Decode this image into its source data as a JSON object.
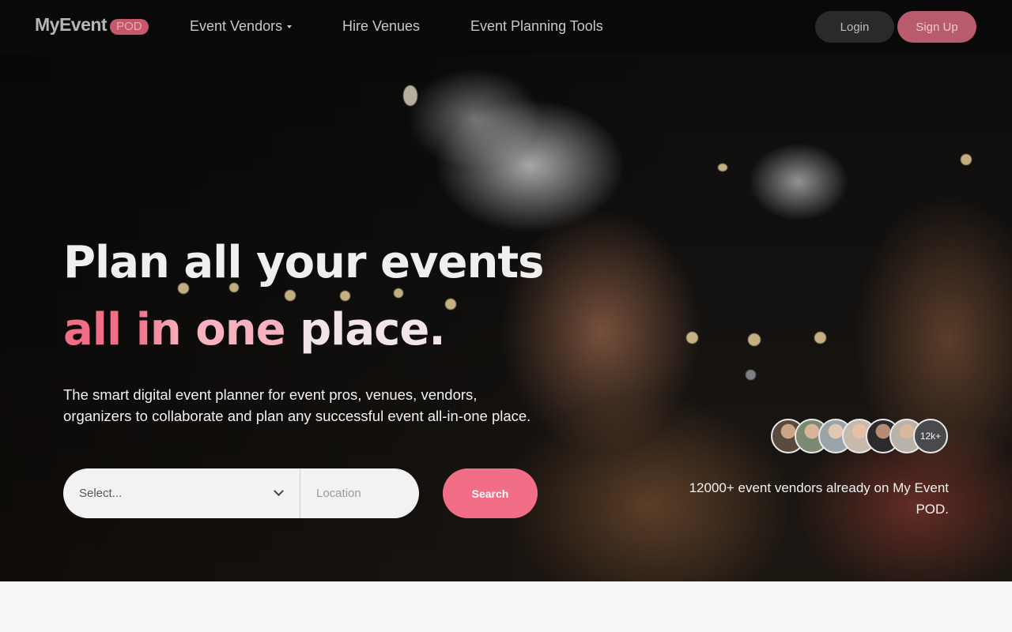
{
  "brand": {
    "name": "MyEvent",
    "badge": "POD"
  },
  "nav": {
    "links": [
      {
        "label": "Event Vendors",
        "has_dropdown": true
      },
      {
        "label": "Hire Venues"
      },
      {
        "label": "Event Planning Tools"
      }
    ],
    "login_label": "Login",
    "signup_label": "Sign Up"
  },
  "hero": {
    "headline_line1": "Plan all your events",
    "headline_line2_words": [
      "all",
      "in",
      "one",
      "place."
    ],
    "subtext": "The smart digital event planner for event pros, venues, vendors, organizers to collaborate and plan any successful event all-in-one place."
  },
  "search": {
    "select_placeholder": "Select...",
    "location_placeholder": "Location",
    "button_label": "Search"
  },
  "social_proof": {
    "avatar_count_label": "12k+",
    "text": "12000+ event vendors already on My Event POD."
  },
  "colors": {
    "accent": "#f26e86",
    "accent_light": "#f6b2bf",
    "nav_bg": "#0a0a0a",
    "signup_bg": "#b85b6c"
  }
}
